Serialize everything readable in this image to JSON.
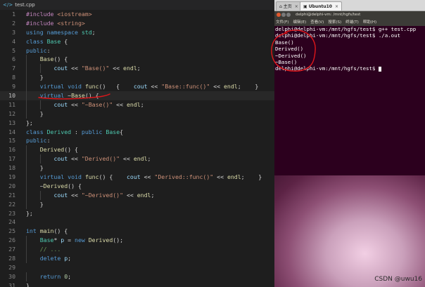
{
  "editor": {
    "tab_icon": "cpp-file-icon",
    "tab_name": "test.cpp",
    "current_line": 10,
    "lines": [
      {
        "n": "1",
        "tokens": [
          {
            "t": "#include ",
            "c": "pp"
          },
          {
            "t": "<iostream>",
            "c": "str"
          }
        ]
      },
      {
        "n": "2",
        "tokens": [
          {
            "t": "#include ",
            "c": "pp"
          },
          {
            "t": "<string>",
            "c": "str"
          }
        ]
      },
      {
        "n": "3",
        "tokens": [
          {
            "t": "using ",
            "c": "kw"
          },
          {
            "t": "namespace ",
            "c": "kw"
          },
          {
            "t": "std",
            "c": "ty"
          },
          {
            "t": ";",
            "c": "pl"
          }
        ]
      },
      {
        "n": "4",
        "tokens": [
          {
            "t": "class ",
            "c": "kw"
          },
          {
            "t": "Base",
            "c": "ty"
          },
          {
            "t": " {",
            "c": "pl"
          }
        ]
      },
      {
        "n": "5",
        "tokens": [
          {
            "t": "public",
            "c": "kw"
          },
          {
            "t": ":",
            "c": "pl"
          }
        ]
      },
      {
        "n": "6",
        "tokens": [
          {
            "t": "    ",
            "c": "pl"
          },
          {
            "t": "Base",
            "c": "fn"
          },
          {
            "t": "() {",
            "c": "pl"
          }
        ]
      },
      {
        "n": "7",
        "tokens": [
          {
            "t": "        ",
            "c": "pl"
          },
          {
            "t": "cout",
            "c": "var"
          },
          {
            "t": " << ",
            "c": "pl"
          },
          {
            "t": "\"Base()\"",
            "c": "str"
          },
          {
            "t": " << ",
            "c": "pl"
          },
          {
            "t": "endl",
            "c": "fn"
          },
          {
            "t": ";",
            "c": "pl"
          }
        ]
      },
      {
        "n": "8",
        "tokens": [
          {
            "t": "    }",
            "c": "pl"
          }
        ]
      },
      {
        "n": "9",
        "tokens": [
          {
            "t": "    ",
            "c": "pl"
          },
          {
            "t": "virtual ",
            "c": "kw"
          },
          {
            "t": "void ",
            "c": "kw"
          },
          {
            "t": "func",
            "c": "fn"
          },
          {
            "t": "()   {    ",
            "c": "pl"
          },
          {
            "t": "cout",
            "c": "var"
          },
          {
            "t": " << ",
            "c": "pl"
          },
          {
            "t": "\"Base::func()\"",
            "c": "str"
          },
          {
            "t": " << ",
            "c": "pl"
          },
          {
            "t": "endl",
            "c": "fn"
          },
          {
            "t": ";    }",
            "c": "pl"
          }
        ]
      },
      {
        "n": "10",
        "tokens": [
          {
            "t": "    ",
            "c": "pl"
          },
          {
            "t": "virtual ",
            "c": "kw"
          },
          {
            "t": "~",
            "c": "pl"
          },
          {
            "t": "Base",
            "c": "fn"
          },
          {
            "t": "() {",
            "c": "pl"
          }
        ]
      },
      {
        "n": "11",
        "tokens": [
          {
            "t": "        ",
            "c": "pl"
          },
          {
            "t": "cout",
            "c": "var"
          },
          {
            "t": " << ",
            "c": "pl"
          },
          {
            "t": "\"~Base()\"",
            "c": "str"
          },
          {
            "t": " << ",
            "c": "pl"
          },
          {
            "t": "endl",
            "c": "fn"
          },
          {
            "t": ";",
            "c": "pl"
          }
        ]
      },
      {
        "n": "12",
        "tokens": [
          {
            "t": "    }",
            "c": "pl"
          }
        ]
      },
      {
        "n": "13",
        "tokens": [
          {
            "t": "};",
            "c": "pl"
          }
        ]
      },
      {
        "n": "14",
        "tokens": [
          {
            "t": "class ",
            "c": "kw"
          },
          {
            "t": "Derived",
            "c": "ty"
          },
          {
            "t": " : ",
            "c": "pl"
          },
          {
            "t": "public ",
            "c": "kw"
          },
          {
            "t": "Base",
            "c": "ty"
          },
          {
            "t": "{",
            "c": "pl"
          }
        ]
      },
      {
        "n": "15",
        "tokens": [
          {
            "t": "public",
            "c": "kw"
          },
          {
            "t": ":",
            "c": "pl"
          }
        ]
      },
      {
        "n": "16",
        "tokens": [
          {
            "t": "    ",
            "c": "pl"
          },
          {
            "t": "Derived",
            "c": "fn"
          },
          {
            "t": "() {",
            "c": "pl"
          }
        ]
      },
      {
        "n": "17",
        "tokens": [
          {
            "t": "        ",
            "c": "pl"
          },
          {
            "t": "cout",
            "c": "var"
          },
          {
            "t": " << ",
            "c": "pl"
          },
          {
            "t": "\"Derived()\"",
            "c": "str"
          },
          {
            "t": " << ",
            "c": "pl"
          },
          {
            "t": "endl",
            "c": "fn"
          },
          {
            "t": ";",
            "c": "pl"
          }
        ]
      },
      {
        "n": "18",
        "tokens": [
          {
            "t": "    }",
            "c": "pl"
          }
        ]
      },
      {
        "n": "19",
        "tokens": [
          {
            "t": "    ",
            "c": "pl"
          },
          {
            "t": "virtual ",
            "c": "kw"
          },
          {
            "t": "void ",
            "c": "kw"
          },
          {
            "t": "func",
            "c": "fn"
          },
          {
            "t": "() {    ",
            "c": "pl"
          },
          {
            "t": "cout",
            "c": "var"
          },
          {
            "t": " << ",
            "c": "pl"
          },
          {
            "t": "\"Derived::func()\"",
            "c": "str"
          },
          {
            "t": " << ",
            "c": "pl"
          },
          {
            "t": "endl",
            "c": "fn"
          },
          {
            "t": ";    }",
            "c": "pl"
          }
        ]
      },
      {
        "n": "20",
        "tokens": [
          {
            "t": "    ~",
            "c": "pl"
          },
          {
            "t": "Derived",
            "c": "fn"
          },
          {
            "t": "() {",
            "c": "pl"
          }
        ]
      },
      {
        "n": "21",
        "tokens": [
          {
            "t": "        ",
            "c": "pl"
          },
          {
            "t": "cout",
            "c": "var"
          },
          {
            "t": " << ",
            "c": "pl"
          },
          {
            "t": "\"~Derived()\"",
            "c": "str"
          },
          {
            "t": " << ",
            "c": "pl"
          },
          {
            "t": "endl",
            "c": "fn"
          },
          {
            "t": ";",
            "c": "pl"
          }
        ]
      },
      {
        "n": "22",
        "tokens": [
          {
            "t": "    }",
            "c": "pl"
          }
        ]
      },
      {
        "n": "23",
        "tokens": [
          {
            "t": "};",
            "c": "pl"
          }
        ]
      },
      {
        "n": "24",
        "tokens": []
      },
      {
        "n": "25",
        "tokens": [
          {
            "t": "int ",
            "c": "kw"
          },
          {
            "t": "main",
            "c": "fn"
          },
          {
            "t": "() {",
            "c": "pl"
          }
        ]
      },
      {
        "n": "26",
        "tokens": [
          {
            "t": "    ",
            "c": "pl"
          },
          {
            "t": "Base",
            "c": "ty"
          },
          {
            "t": "* ",
            "c": "pl"
          },
          {
            "t": "p",
            "c": "var"
          },
          {
            "t": " = ",
            "c": "pl"
          },
          {
            "t": "new ",
            "c": "kw"
          },
          {
            "t": "Derived",
            "c": "fn"
          },
          {
            "t": "();",
            "c": "pl"
          }
        ]
      },
      {
        "n": "27",
        "tokens": [
          {
            "t": "    ",
            "c": "pl"
          },
          {
            "t": "// ...",
            "c": "cm"
          }
        ]
      },
      {
        "n": "28",
        "tokens": [
          {
            "t": "    ",
            "c": "pl"
          },
          {
            "t": "delete ",
            "c": "kw"
          },
          {
            "t": "p",
            "c": "var"
          },
          {
            "t": ";",
            "c": "pl"
          }
        ]
      },
      {
        "n": "29",
        "tokens": []
      },
      {
        "n": "30",
        "tokens": [
          {
            "t": "    ",
            "c": "pl"
          },
          {
            "t": "return ",
            "c": "kw"
          },
          {
            "t": "0",
            "c": "num"
          },
          {
            "t": ";",
            "c": "pl"
          }
        ]
      },
      {
        "n": "31",
        "tokens": [
          {
            "t": "}",
            "c": "pl"
          }
        ]
      }
    ]
  },
  "vm": {
    "tabs": [
      {
        "icon": "home-icon",
        "label": "主页",
        "active": false
      },
      {
        "icon": "vm-icon",
        "label": "Ubuntu10",
        "active": true
      }
    ],
    "close_glyph": "×",
    "terminal_title": "delphi@delphi-vm: /mnt/hgfs/test",
    "menu": [
      "文件(F)",
      "编辑(E)",
      "查看(V)",
      "搜索(S)",
      "终端(T)",
      "帮助(H)"
    ],
    "terminal_lines": [
      "delphi@delphi-vm:/mnt/hgfs/test$ g++ test.cpp",
      "delphi@delphi-vm:/mnt/hgfs/test$ ./a.out",
      "Base()",
      "Derived()",
      "~Derived()",
      "~Base()",
      "delphi@delphi-vm:/mnt/hgfs/test$ "
    ]
  },
  "watermark": "CSDN @uwu16",
  "colors": {
    "editor_bg": "#1e1e1e",
    "terminal_bg": "#2c001e",
    "annotation": "#e0161a"
  }
}
